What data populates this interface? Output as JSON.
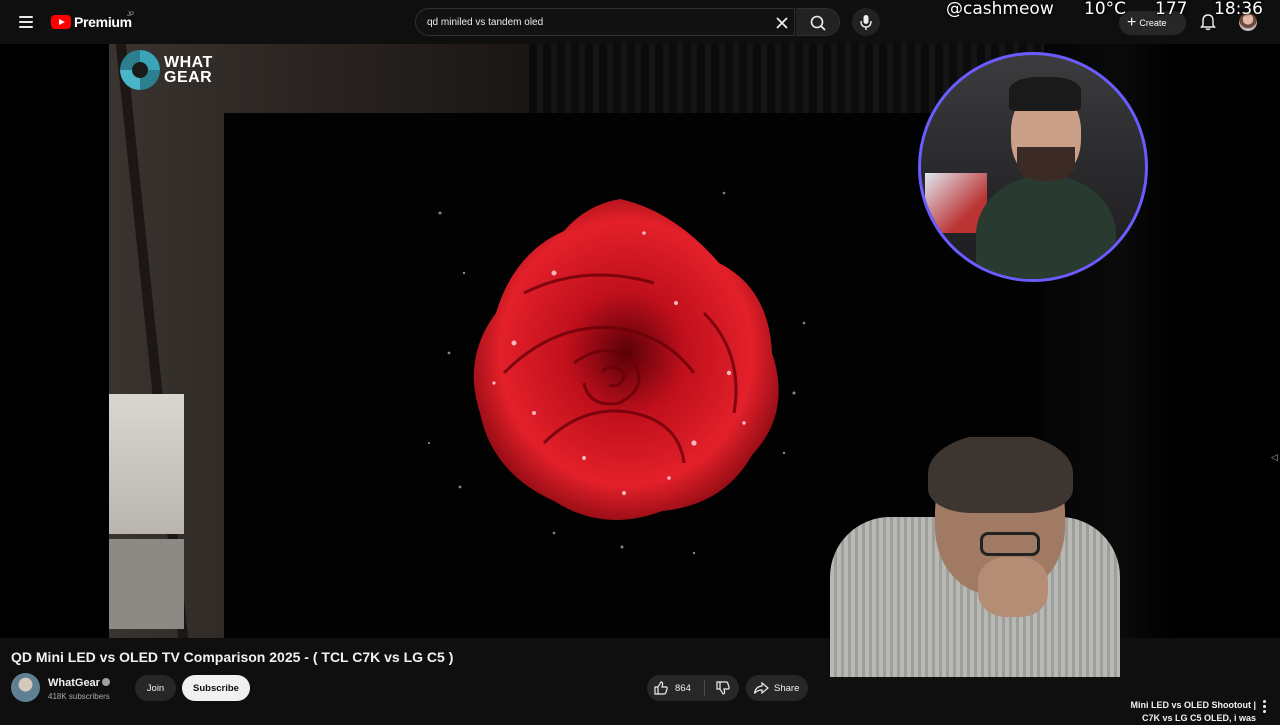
{
  "header": {
    "logo_text": "Premium",
    "region": "JP",
    "search_query": "qd miniled vs tandem oled",
    "create_label": "Create"
  },
  "stream_overlay": {
    "handle": "@cashmeow",
    "temperature": "10°C",
    "counter": "177",
    "time": "18:36"
  },
  "player": {
    "watermark": "WHAT GEAR"
  },
  "video": {
    "title": "QD Mini LED vs OLED TV Comparison 2025 - ( TCL C7K vs LG C5 )",
    "channel": "WhatGear",
    "subscribers": "418K subscribers",
    "join_label": "Join",
    "subscribe_label": "Subscribe",
    "likes": "864",
    "share_label": "Share"
  },
  "next_up": {
    "title": "Mini LED vs OLED Shootout | C7K vs LG C5 OLED, i was"
  },
  "colors": {
    "background": "#0f0f0f",
    "brand_red": "#ff0000",
    "facecam_ring": "#6b5cff"
  }
}
